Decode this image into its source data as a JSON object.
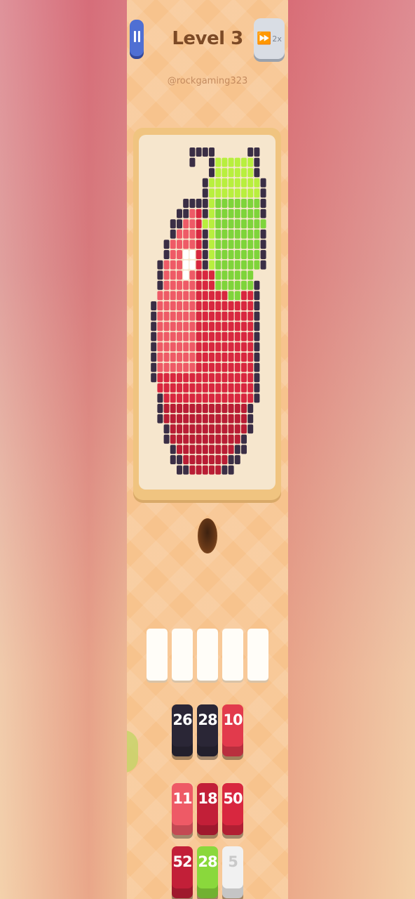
{
  "header": {
    "pause_icon": "pause-icon",
    "level_title": "Level 3",
    "handle": "@rockgaming323",
    "speed_icon": "fast-forward-icon",
    "speed_label": "2x"
  },
  "answer_slots": [
    {
      "filled": false
    },
    {
      "filled": false
    },
    {
      "filled": false
    },
    {
      "filled": false
    },
    {
      "filled": false
    }
  ],
  "blocks": [
    {
      "count": "26",
      "color": "#2a2636"
    },
    {
      "count": "28",
      "color": "#2a2636"
    },
    {
      "count": "10",
      "color": "#e23a4c"
    },
    {
      "count": "11",
      "color": "#ee5a66"
    },
    {
      "count": "18",
      "color": "#c21f38"
    },
    {
      "count": "50",
      "color": "#d8273f"
    },
    {
      "count": "52",
      "color": "#c21f38"
    },
    {
      "count": "28",
      "color": "#8ad83c"
    },
    {
      "count": "5",
      "color": "#f1f1f1"
    }
  ],
  "palette": {
    "outline": "#3a2e45",
    "red": "#d8273f",
    "dark_red": "#b81d34",
    "light_red": "#ee5a66",
    "green": "#7ed43a",
    "light_green": "#b8ef3e",
    "white": "#ffffff"
  }
}
